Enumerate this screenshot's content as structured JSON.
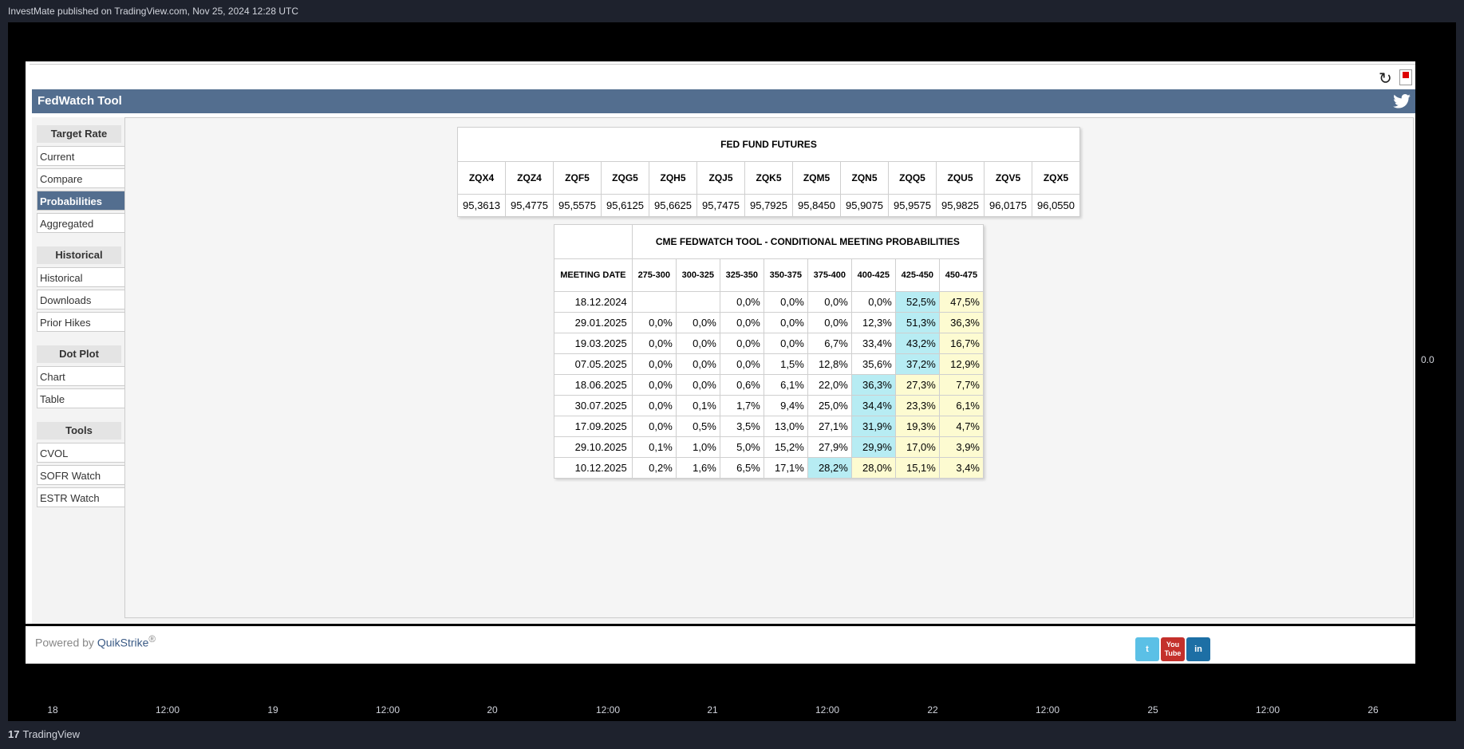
{
  "publish_line": "InvestMate published on TradingView.com, Nov 25, 2024 12:28 UTC",
  "price_label": "0.0",
  "x_ticks": [
    "18",
    "12:00",
    "19",
    "12:00",
    "20",
    "12:00",
    "21",
    "12:00",
    "22",
    "12:00",
    "25",
    "12:00",
    "26"
  ],
  "brand": {
    "logo": "17",
    "name": "TradingView"
  },
  "tool": {
    "title": "FedWatch Tool",
    "sidebar": [
      {
        "header": "Target Rate",
        "items": [
          "Current",
          "Compare",
          "Probabilities",
          "Aggregated"
        ]
      },
      {
        "header": "Historical",
        "items": [
          "Historical",
          "Downloads",
          "Prior Hikes"
        ]
      },
      {
        "header": "Dot Plot",
        "items": [
          "Chart",
          "Table"
        ]
      },
      {
        "header": "Tools",
        "items": [
          "CVOL",
          "SOFR Watch",
          "ESTR Watch"
        ]
      }
    ],
    "active_item": "Probabilities",
    "futures": {
      "title": "FED FUND FUTURES",
      "headers": [
        "ZQX4",
        "ZQZ4",
        "ZQF5",
        "ZQG5",
        "ZQH5",
        "ZQJ5",
        "ZQK5",
        "ZQM5",
        "ZQN5",
        "ZQQ5",
        "ZQU5",
        "ZQV5",
        "ZQX5"
      ],
      "values": [
        "95,3613",
        "95,4775",
        "95,5575",
        "95,6125",
        "95,6625",
        "95,7475",
        "95,7925",
        "95,8450",
        "95,9075",
        "95,9575",
        "95,9825",
        "96,0175",
        "96,0550"
      ]
    },
    "probabilities": {
      "title": "CME FEDWATCH TOOL - CONDITIONAL MEETING PROBABILITIES",
      "headers": [
        "MEETING DATE",
        "275-300",
        "300-325",
        "325-350",
        "350-375",
        "375-400",
        "400-425",
        "425-450",
        "450-475"
      ],
      "rows": [
        {
          "date": "18.12.2024",
          "cells": [
            "",
            "",
            "0,0%",
            "0,0%",
            "0,0%",
            "0,0%",
            "52,5%",
            "47,5%"
          ],
          "hl": [
            "",
            "",
            "",
            "",
            "",
            "",
            "b",
            "y"
          ]
        },
        {
          "date": "29.01.2025",
          "cells": [
            "0,0%",
            "0,0%",
            "0,0%",
            "0,0%",
            "0,0%",
            "12,3%",
            "51,3%",
            "36,3%"
          ],
          "hl": [
            "",
            "",
            "",
            "",
            "",
            "",
            "b",
            "y"
          ]
        },
        {
          "date": "19.03.2025",
          "cells": [
            "0,0%",
            "0,0%",
            "0,0%",
            "0,0%",
            "6,7%",
            "33,4%",
            "43,2%",
            "16,7%"
          ],
          "hl": [
            "",
            "",
            "",
            "",
            "",
            "",
            "b",
            "y"
          ]
        },
        {
          "date": "07.05.2025",
          "cells": [
            "0,0%",
            "0,0%",
            "0,0%",
            "1,5%",
            "12,8%",
            "35,6%",
            "37,2%",
            "12,9%"
          ],
          "hl": [
            "",
            "",
            "",
            "",
            "",
            "",
            "b",
            "y"
          ]
        },
        {
          "date": "18.06.2025",
          "cells": [
            "0,0%",
            "0,0%",
            "0,6%",
            "6,1%",
            "22,0%",
            "36,3%",
            "27,3%",
            "7,7%"
          ],
          "hl": [
            "",
            "",
            "",
            "",
            "",
            "b",
            "y",
            "y"
          ]
        },
        {
          "date": "30.07.2025",
          "cells": [
            "0,0%",
            "0,1%",
            "1,7%",
            "9,4%",
            "25,0%",
            "34,4%",
            "23,3%",
            "6,1%"
          ],
          "hl": [
            "",
            "",
            "",
            "",
            "",
            "b",
            "y",
            "y"
          ]
        },
        {
          "date": "17.09.2025",
          "cells": [
            "0,0%",
            "0,5%",
            "3,5%",
            "13,0%",
            "27,1%",
            "31,9%",
            "19,3%",
            "4,7%"
          ],
          "hl": [
            "",
            "",
            "",
            "",
            "",
            "b",
            "y",
            "y"
          ]
        },
        {
          "date": "29.10.2025",
          "cells": [
            "0,1%",
            "1,0%",
            "5,0%",
            "15,2%",
            "27,9%",
            "29,9%",
            "17,0%",
            "3,9%"
          ],
          "hl": [
            "",
            "",
            "",
            "",
            "",
            "b",
            "y",
            "y"
          ]
        },
        {
          "date": "10.12.2025",
          "cells": [
            "0,2%",
            "1,6%",
            "6,5%",
            "17,1%",
            "28,2%",
            "28,0%",
            "15,1%",
            "3,4%"
          ],
          "hl": [
            "",
            "",
            "",
            "",
            "b",
            "y",
            "y",
            "y"
          ]
        }
      ]
    },
    "footer": {
      "powered": "Powered by",
      "brand": "QuikStrike",
      "reg": "®"
    },
    "social": [
      {
        "name": "twitter-icon",
        "label": "t",
        "color": "#5bc0e6"
      },
      {
        "name": "youtube-icon",
        "label": "You Tube",
        "color": "#c4302b"
      },
      {
        "name": "linkedin-icon",
        "label": "in",
        "color": "#1d6fa5"
      }
    ],
    "colors": {
      "header_bar": "#536e8f",
      "highlight_blue": "#b7ecf3",
      "highlight_yellow": "#fdfbd1"
    }
  }
}
